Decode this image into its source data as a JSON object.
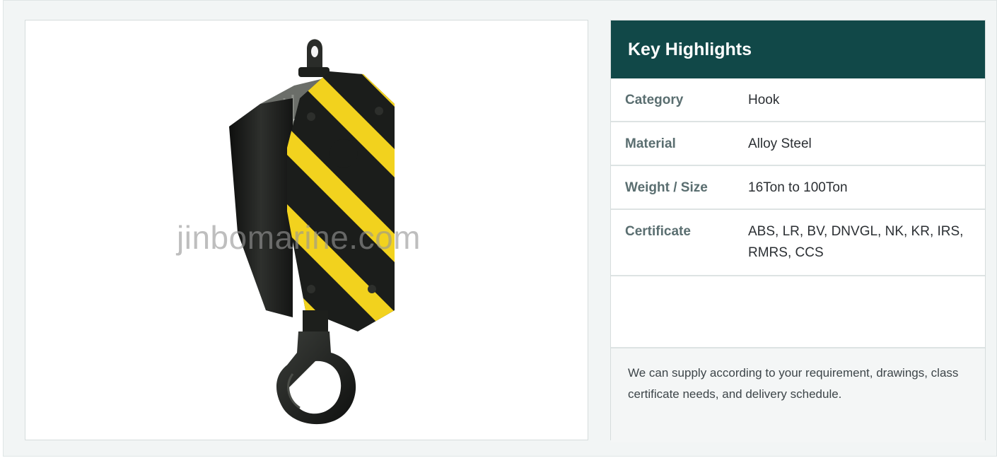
{
  "product_image": {
    "watermark": "jinbomarine.com",
    "subject": "crane hook block with yellow and black hazard stripes"
  },
  "highlights": {
    "title": "Key Highlights",
    "rows": [
      {
        "label": "Category",
        "value": "Hook"
      },
      {
        "label": "Material",
        "value": "Alloy Steel"
      },
      {
        "label": "Weight / Size",
        "value": "16Ton to 100Ton"
      },
      {
        "label": "Certificate",
        "value": "ABS, LR, BV, DNVGL, NK, KR, IRS, RMRS, CCS"
      }
    ],
    "note": "We can supply according to your requirement, drawings, class certificate needs, and delivery schedule."
  },
  "colors": {
    "header_bg": "#114848",
    "page_bg": "#f2f5f5",
    "stripe_yellow": "#f2d21e",
    "hook_black": "#1b1d1b"
  }
}
